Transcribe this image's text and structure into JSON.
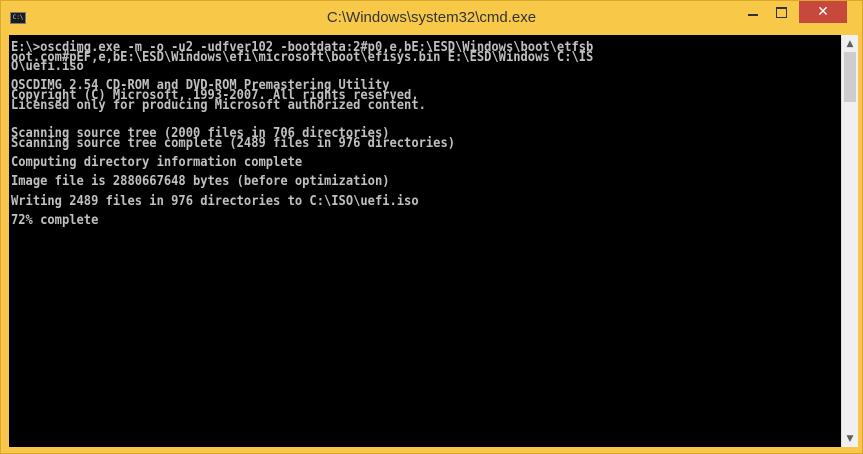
{
  "window": {
    "title": "C:\\Windows\\system32\\cmd.exe",
    "app_icon_text": "C:\\",
    "close_glyph": "✕"
  },
  "console": {
    "lines": [
      "E:\\>oscdimg.exe -m -o -u2 -udfver102 -bootdata:2#p0,e,bE:\\ESD\\Windows\\boot\\etfsb",
      "oot.com#pEF,e,bE:\\ESD\\Windows\\efi\\microsoft\\boot\\efisys.bin E:\\ESD\\Windows C:\\IS",
      "O\\uefi.iso",
      "",
      "OSCDIMG 2.54 CD-ROM and DVD-ROM Premastering Utility",
      "Copyright (C) Microsoft, 1993-2007. All rights reserved.",
      "Licensed only for producing Microsoft authorized content.",
      "",
      "",
      "Scanning source tree (2000 files in 706 directories)",
      "Scanning source tree complete (2489 files in 976 directories)",
      "",
      "Computing directory information complete",
      "",
      "Image file is 2880667648 bytes (before optimization)",
      "",
      "Writing 2489 files in 976 directories to C:\\ISO\\uefi.iso",
      "",
      "72% complete"
    ]
  },
  "icons": {
    "minimize": "minimize-icon",
    "maximize": "maximize-icon",
    "close": "close-icon",
    "scroll_up": "chevron-up-icon",
    "scroll_down": "chevron-down-icon"
  },
  "colors": {
    "titlebar": "#f8c849",
    "close_button": "#c7483d",
    "console_bg": "#000000",
    "console_text": "#c0c0c0"
  }
}
